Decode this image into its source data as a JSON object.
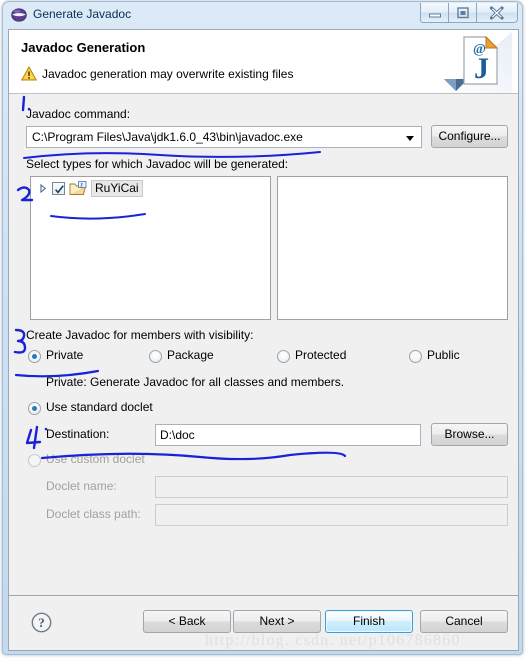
{
  "window": {
    "title": "Generate Javadoc",
    "icon": "eclipse-sphere-icon",
    "minimize_tooltip": "Minimize",
    "maximize_tooltip": "Maximize",
    "close_tooltip": "Close"
  },
  "banner": {
    "title": "Javadoc Generation",
    "message": "Javadoc generation may overwrite existing files",
    "warning_icon": "warning-triangle-icon",
    "art_icon": "javadoc-document-icon"
  },
  "page": {
    "command_label": "Javadoc command:",
    "command_value": "C:\\Program Files\\Java\\jdk1.6.0_43\\bin\\javadoc.exe",
    "configure_label": "Configure...",
    "types_label": "Select types for which Javadoc will be generated:",
    "tree": {
      "items": [
        {
          "label": "RuYiCai",
          "checked": true,
          "expandable": true,
          "icon": "java-project-folder-icon",
          "selected": true
        }
      ]
    },
    "right_pane_items": [],
    "visibility_label": "Create Javadoc for members with visibility:",
    "visibility_options": [
      {
        "label": "Private",
        "selected": true
      },
      {
        "label": "Package",
        "selected": false
      },
      {
        "label": "Protected",
        "selected": false
      },
      {
        "label": "Public",
        "selected": false
      }
    ],
    "visibility_hint": "Private: Generate Javadoc for all classes and members.",
    "doclet_options": [
      {
        "label": "Use standard doclet",
        "selected": true
      },
      {
        "label": "Use custom doclet",
        "selected": false
      }
    ],
    "destination_label": "Destination:",
    "destination_value": "D:\\doc",
    "browse_label": "Browse...",
    "doclet_name_label": "Doclet name:",
    "doclet_name_value": "",
    "doclet_classpath_label": "Doclet class path:",
    "doclet_classpath_value": "",
    "disabled_fields": true
  },
  "buttons": {
    "help": "help-icon",
    "back": "< Back",
    "next": "Next >",
    "finish": "Finish",
    "cancel": "Cancel",
    "default_button": "Finish"
  },
  "annotations": {
    "color": "#1a22d8",
    "marks": [
      {
        "text": "1.",
        "target": "javadoc-command-field"
      },
      {
        "text": "2",
        "target": "types-tree"
      },
      {
        "text": "3",
        "target": "visibility-private"
      },
      {
        "text": "4",
        "target": "destination-field"
      }
    ]
  },
  "watermark": {
    "text": "http://blog. csdn. net/p106786860",
    "color": "#e2dede"
  }
}
